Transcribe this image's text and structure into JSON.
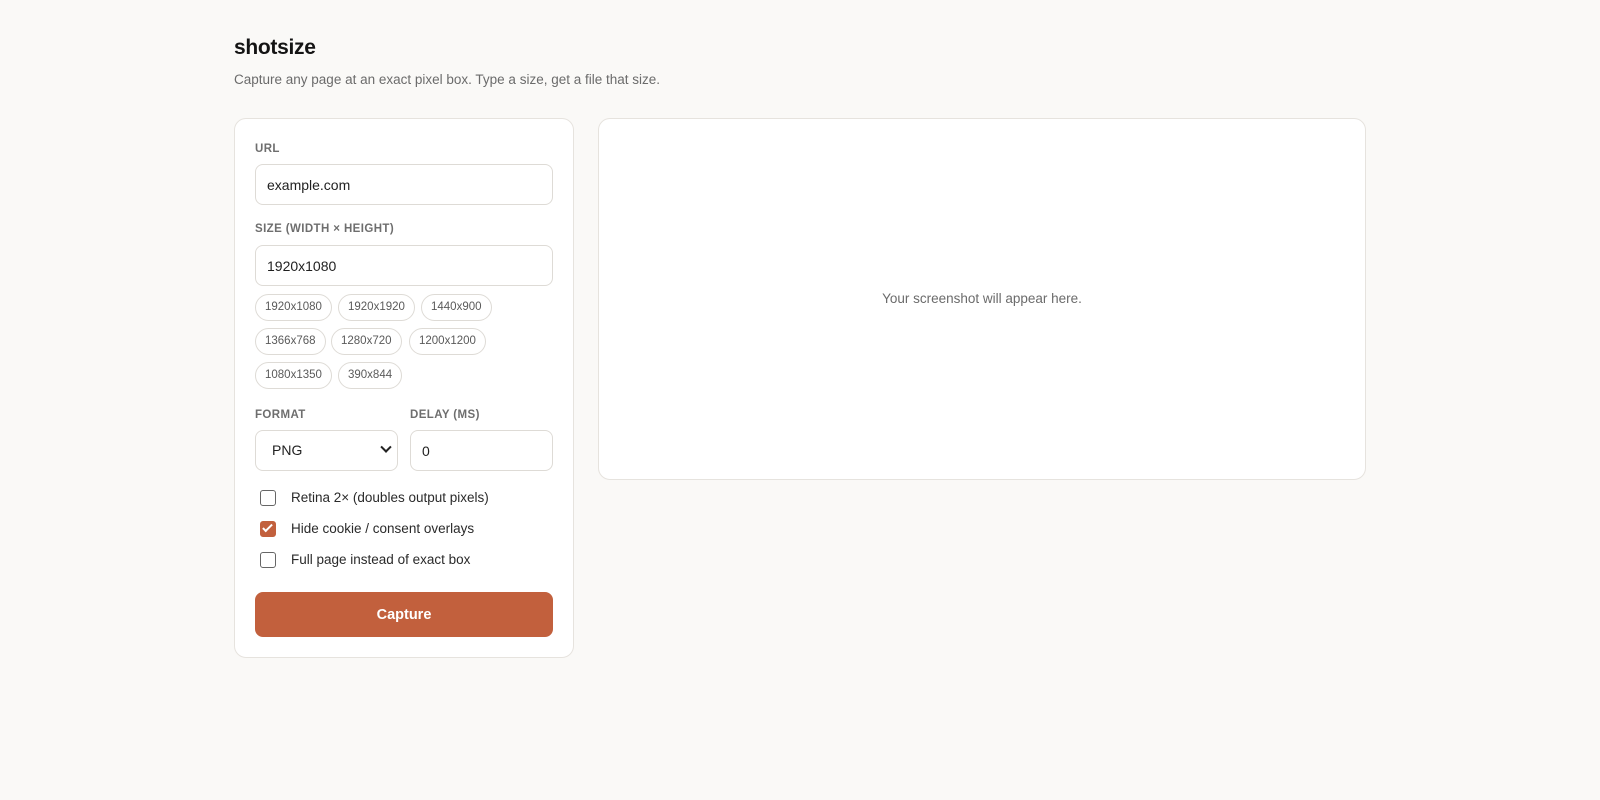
{
  "app": {
    "title": "shotsize",
    "subtitle": "Capture any page at an exact pixel box. Type a size, get a file that size."
  },
  "form": {
    "url_label": "URL",
    "url_value": "example.com",
    "size_label": "SIZE (WIDTH × HEIGHT)",
    "size_value": "1920x1080",
    "presets": [
      "1920x1080",
      "1920x1920",
      "1440x900",
      "1366x768",
      "1280x720",
      "1200x1200",
      "1080x1350",
      "390x844"
    ],
    "format_label": "FORMAT",
    "format_value": "PNG",
    "delay_label": "DELAY (MS)",
    "delay_value": "0",
    "options": [
      {
        "label": "Retina 2× (doubles output pixels)",
        "checked": false
      },
      {
        "label": "Hide cookie / consent overlays",
        "checked": true
      },
      {
        "label": "Full page instead of exact box",
        "checked": false
      }
    ],
    "capture_label": "Capture"
  },
  "preview": {
    "placeholder": "Your screenshot will appear here."
  },
  "colors": {
    "accent": "#c2603d",
    "background": "#faf9f7",
    "border": "#e6e3de"
  }
}
